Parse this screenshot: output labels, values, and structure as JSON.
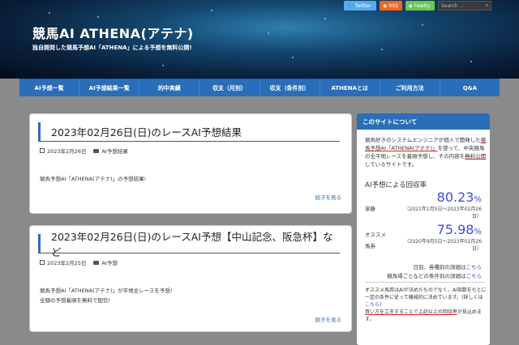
{
  "header": {
    "title": "競馬AI ATHENA(アテナ)",
    "subtitle": "独自開発した競馬予想AI「ATHENA」による予想を無料公開!"
  },
  "topbar": {
    "twitter": "Twitter",
    "rss": "RSS",
    "feedly": "Feedly",
    "search_placeholder": "Search ..."
  },
  "nav": [
    "AI予想一覧",
    "AI予想結果一覧",
    "的中実績",
    "収支（月別）",
    "収支（条件別）",
    "ATHENAとは",
    "ご利用方法",
    "Q&A"
  ],
  "posts": [
    {
      "title": "2023年02月26日(日)のレースAI予想結果",
      "date": "2023年2月26日",
      "category": "AI予想結果",
      "excerpt1": "競馬予想AI「ATHENA(アテナ)」の予想結果!",
      "excerpt2": "",
      "more": "続きを見る"
    },
    {
      "title": "2023年02月26日(日)のレースAI予想【中山記念、阪急杯】など",
      "date": "2023年2月25日",
      "category": "AI予想",
      "excerpt1": "競馬予想AI「ATHENA(アテナ)」が平地全レースを予想!",
      "excerpt2": "全頭の予想着順を無料で配信!",
      "more": "続きを見る"
    }
  ],
  "sidebar": {
    "heading": "このサイトについて",
    "intro_a": "競馬好きのシステムエンジニアが個人で開発した",
    "intro_b": "競馬予想AI「ATHENA(アテナ)」",
    "intro_c": "を使って、中央競馬の全平地レースを着順予想し、その内容を",
    "intro_d": "無料公開",
    "intro_e": "しているサイトです。",
    "rate_heading": "AI予想による回収率",
    "rate1_label": "単勝",
    "rate1_value": "80.23",
    "rate1_unit": "%",
    "rate1_period": "（2021年1月5日～2023年02月26日）",
    "rate2_label": "オススメ馬券",
    "rate2_value": "75.98",
    "rate2_unit": "%",
    "rate2_period": "（2020年9月5日～2023年02月26日）",
    "link1_text": "日別、券種別の詳細は",
    "link1_anchor": "こちら",
    "link2_text": "競馬場ごとなどの条件別の詳細は",
    "link2_anchor": "こちら",
    "note_a": "オススメ馬券はAIが決めたものでなく、AI指数をもとに一定の条件に従って機械的に決めています。(詳しくは",
    "note_link": "こちら",
    "note_b": ")",
    "note_c": "買い方を工夫することで上記以上の回収率",
    "note_d": "が見込めます。"
  }
}
